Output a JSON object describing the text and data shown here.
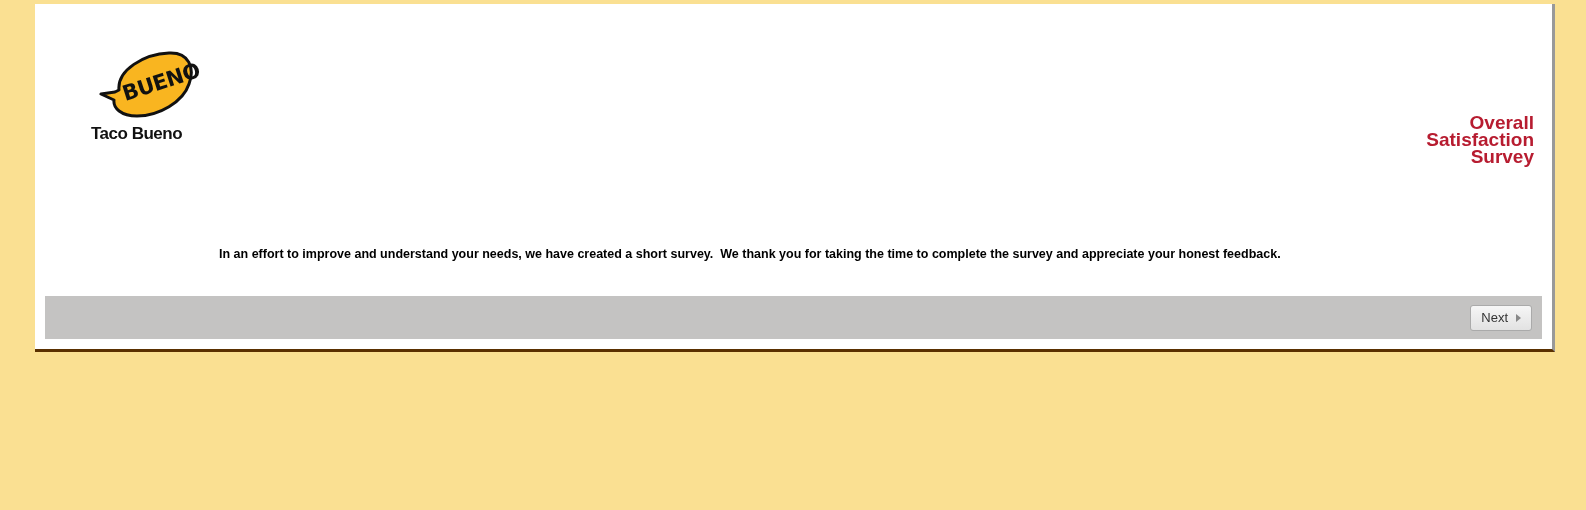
{
  "logo": {
    "bubble_text": "BUENO",
    "brand": "Taco Bueno"
  },
  "title": [
    "Overall",
    "Satisfaction",
    "Survey"
  ],
  "intro": "In an effort to improve and understand your needs, we have created a short survey.  We thank you for taking the time to complete the survey and appreciate your honest feedback.",
  "footer": {
    "buttons": [
      {
        "label": "Next",
        "kind": "next"
      }
    ]
  }
}
